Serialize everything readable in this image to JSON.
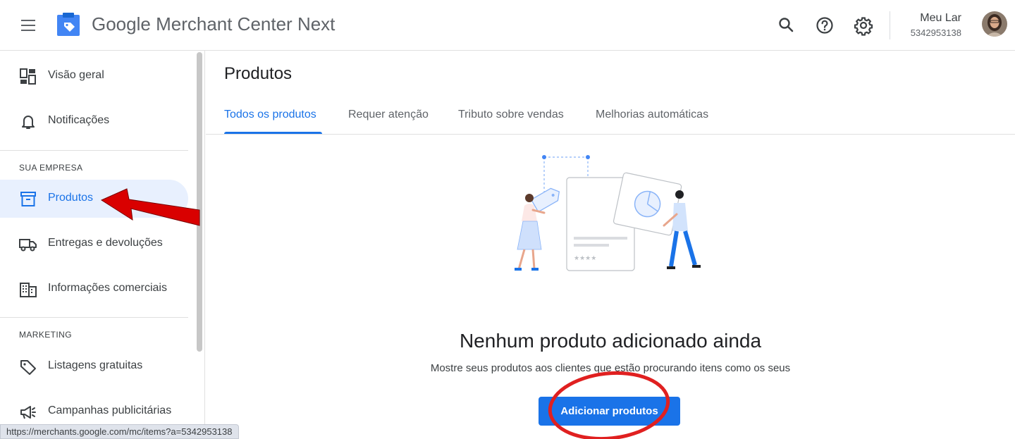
{
  "header": {
    "app_title_google": "Google",
    "app_title_rest": "Merchant Center Next",
    "account_name": "Meu Lar",
    "account_id": "5342953138"
  },
  "sidebar": {
    "items_top": [
      {
        "label": "Visão geral",
        "icon": "dashboard-icon"
      },
      {
        "label": "Notificações",
        "icon": "bell-icon"
      }
    ],
    "section_company": "SUA EMPRESA",
    "items_company": [
      {
        "label": "Produtos",
        "icon": "archive-icon",
        "active": true
      },
      {
        "label": "Entregas e devoluções",
        "icon": "truck-icon"
      },
      {
        "label": "Informações comerciais",
        "icon": "building-icon"
      }
    ],
    "section_marketing": "MARKETING",
    "items_marketing": [
      {
        "label": "Listagens gratuitas",
        "icon": "tag-icon"
      },
      {
        "label": "Campanhas publicitárias",
        "icon": "megaphone-icon"
      }
    ]
  },
  "status_bar_url": "https://merchants.google.com/mc/items?a=5342953138",
  "main": {
    "page_title": "Produtos",
    "tabs": [
      {
        "label": "Todos os produtos",
        "active": true
      },
      {
        "label": "Requer atenção"
      },
      {
        "label": "Tributo sobre vendas"
      },
      {
        "label": "Melhorias automáticas"
      }
    ],
    "empty_title": "Nenhum produto adicionado ainda",
    "empty_subtitle": "Mostre seus produtos aos clientes que estão procurando itens como os seus",
    "add_button": "Adicionar produtos"
  },
  "colors": {
    "accent": "#1a73e8",
    "active_bg": "#e8f0fe",
    "annotation_red": "#e00000"
  }
}
